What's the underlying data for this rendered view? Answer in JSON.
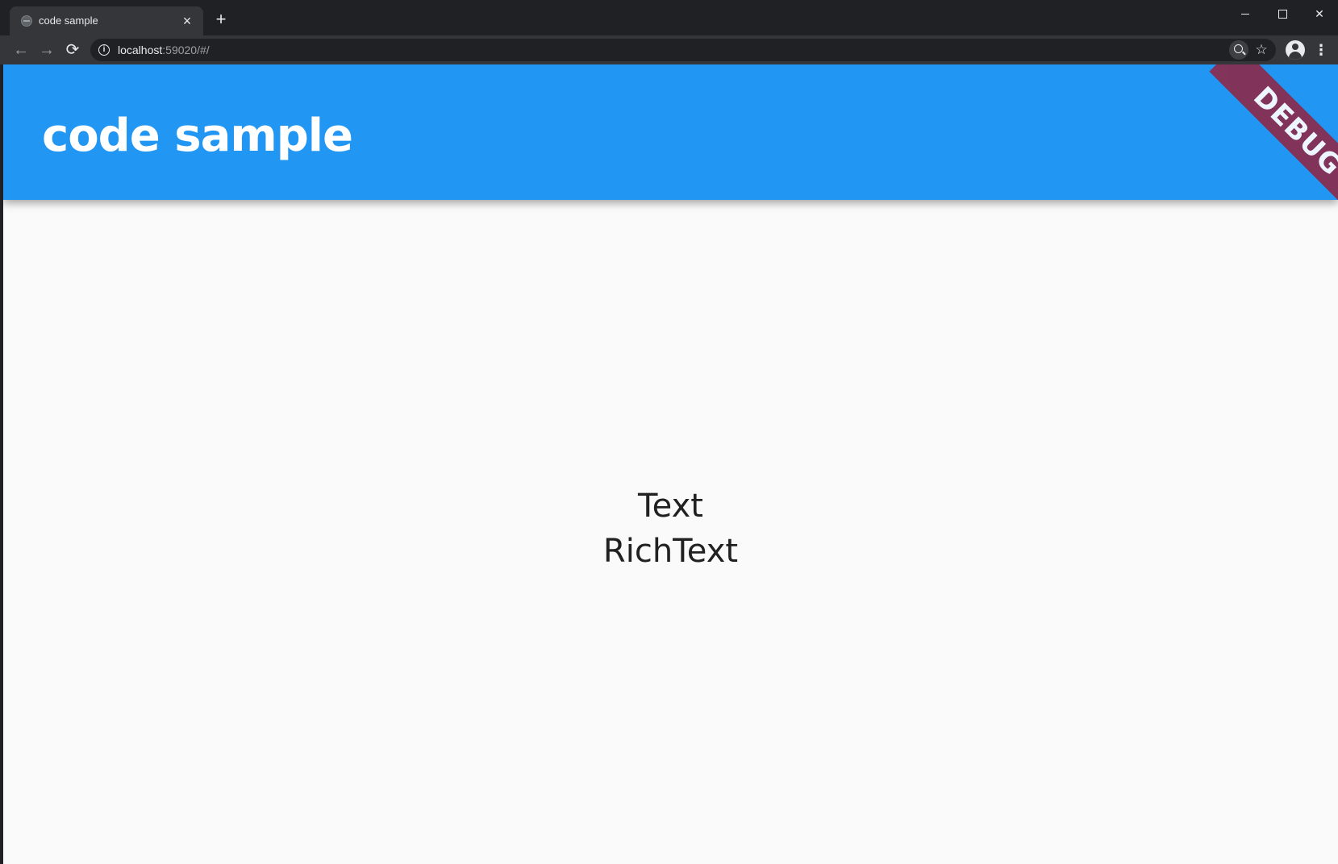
{
  "browser": {
    "tab": {
      "title": "code sample",
      "close_glyph": "×"
    },
    "new_tab_glyph": "+",
    "window_controls": {
      "close_glyph": "✕"
    },
    "nav": {
      "back_glyph": "←",
      "forward_glyph": "→",
      "reload_glyph": "⟳"
    },
    "address": {
      "host": "localhost",
      "rest": ":59020/#/",
      "info_glyph": "i"
    },
    "star_glyph": "☆",
    "menu_glyph": "⋮",
    "icons": [
      "globe-icon",
      "info-icon",
      "zoom-icon",
      "star-icon",
      "profile-icon",
      "menu-icon"
    ]
  },
  "app": {
    "title": "code sample",
    "debug_banner": "DEBUG",
    "body": {
      "text": "Text",
      "rich_text": "RichText"
    }
  },
  "colors": {
    "app_bar": "#2196f3",
    "debug_banner": "#8b2b4e",
    "page_background": "#fafafa",
    "browser_chrome": "#202124"
  }
}
